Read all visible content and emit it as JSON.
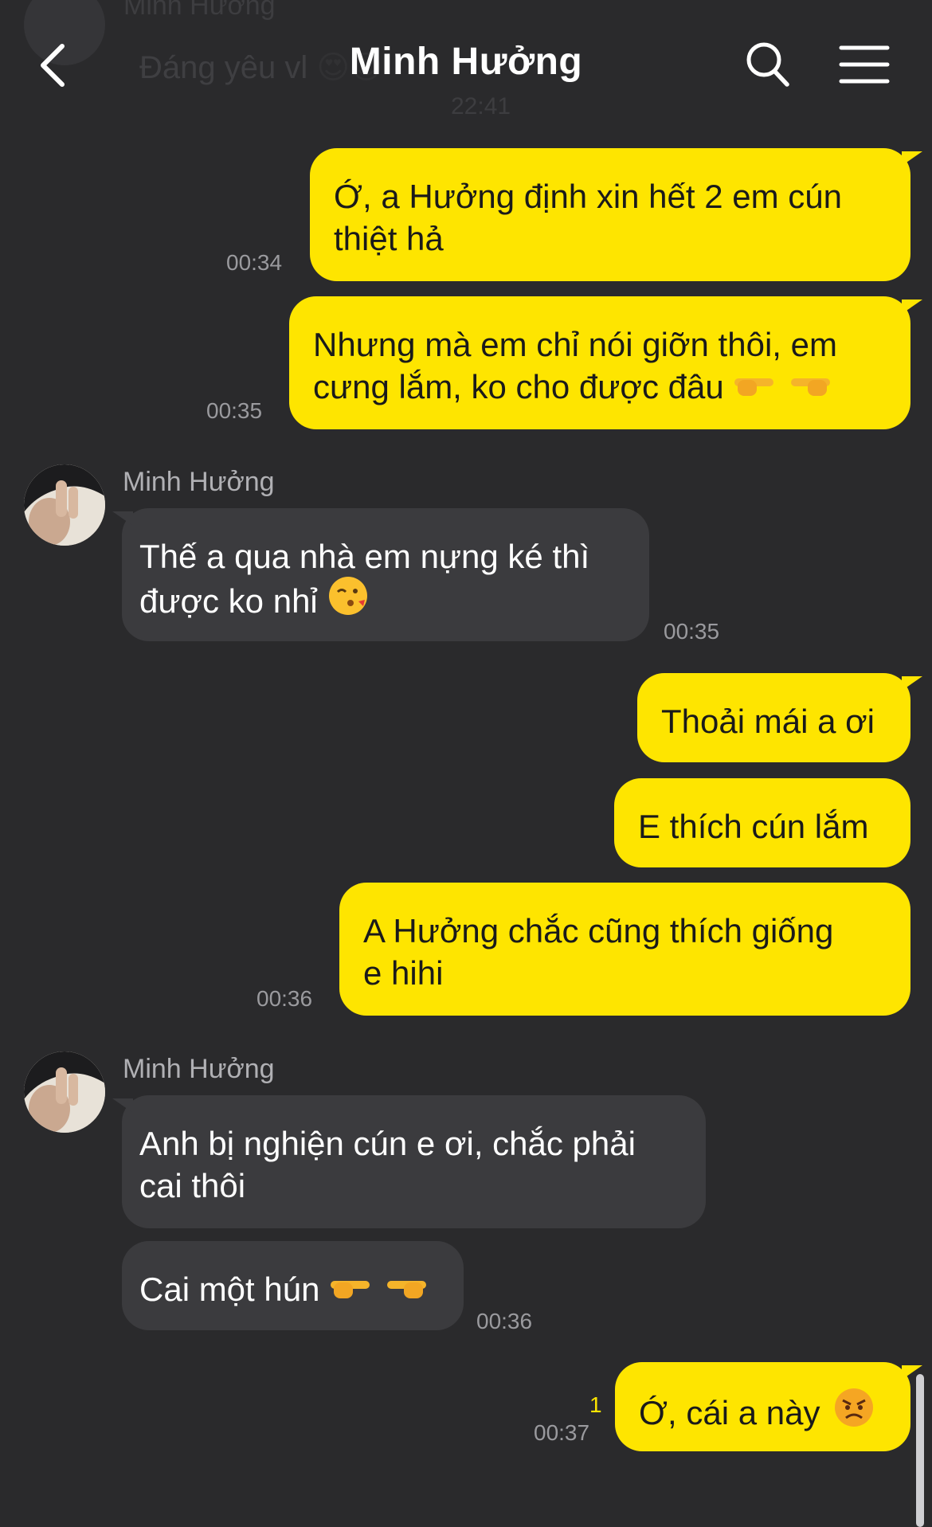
{
  "header": {
    "title": "Minh Hưởng",
    "ghost_sender": "Minh Hưởng",
    "ghost_message": "Đáng yêu vl",
    "ghost_time": "22:41"
  },
  "messages": [
    {
      "from": "me",
      "lines": [
        "Ớ, a Hưởng định xin hết 2 em cún",
        "thiệt hả"
      ],
      "time": "00:34"
    },
    {
      "from": "me",
      "lines": [
        "Nhưng mà em chỉ nói giỡn thôi, em",
        "cưng lắm, ko cho được đâu"
      ],
      "time": "00:35"
    },
    {
      "from": "them",
      "sender": "Minh Hưởng",
      "lines": [
        "Thế a qua nhà em nựng ké thì",
        "được ko nhỉ"
      ],
      "time": "00:35"
    },
    {
      "from": "me",
      "lines": [
        "Thoải mái a ơi"
      ]
    },
    {
      "from": "me",
      "lines": [
        "E thích cún lắm"
      ]
    },
    {
      "from": "me",
      "lines": [
        "A Hưởng chắc cũng thích giống",
        "e hihi"
      ],
      "time": "00:36"
    },
    {
      "from": "them",
      "sender": "Minh Hưởng",
      "lines": [
        "Anh bị nghiện cún e ơi, chắc phải",
        "cai thôi"
      ]
    },
    {
      "from": "them",
      "lines": [
        "Cai một hún"
      ],
      "time": "00:36"
    },
    {
      "from": "me",
      "lines": [
        "Ớ, cái a này"
      ],
      "time": "00:37",
      "unread": "1"
    }
  ],
  "colors": {
    "background": "#2a2a2c",
    "my_bubble": "#fee500",
    "their_bubble": "#3b3b3e"
  },
  "icons": [
    "back-arrow-icon",
    "search-icon",
    "menu-icon",
    "pointing-right-emoji",
    "pointing-left-emoji",
    "kiss-emoji",
    "angry-emoji"
  ]
}
